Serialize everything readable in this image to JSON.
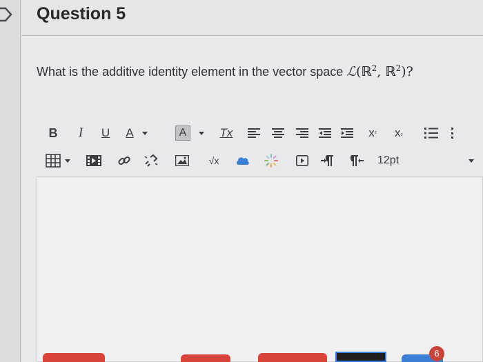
{
  "question": {
    "title": "Question 5",
    "prompt_text": "What is the additive identity element in the vector space ",
    "math_L": "ℒ",
    "math_open": "(",
    "math_R1": "ℝ",
    "math_exp1": "2",
    "math_comma": ", ",
    "math_R2": "ℝ",
    "math_exp2": "2",
    "math_close": ")?"
  },
  "toolbar": {
    "bold_label": "B",
    "italic_label": "I",
    "underline_label": "U",
    "font_color_label": "A",
    "bg_color_label": "A",
    "clear_format_label": "Tx",
    "superscript_label": "x",
    "subscript_label": "x",
    "font_size": "12pt",
    "sqrt_label": "√x"
  },
  "taskbar": {
    "badge_count": "6"
  },
  "colors": {
    "background": "#e5e4e6",
    "editor_background": "#f0eff1",
    "taskbar_red": "#d8433a",
    "taskbar_blue": "#3b7fd6",
    "badge_red": "#c8433a"
  }
}
